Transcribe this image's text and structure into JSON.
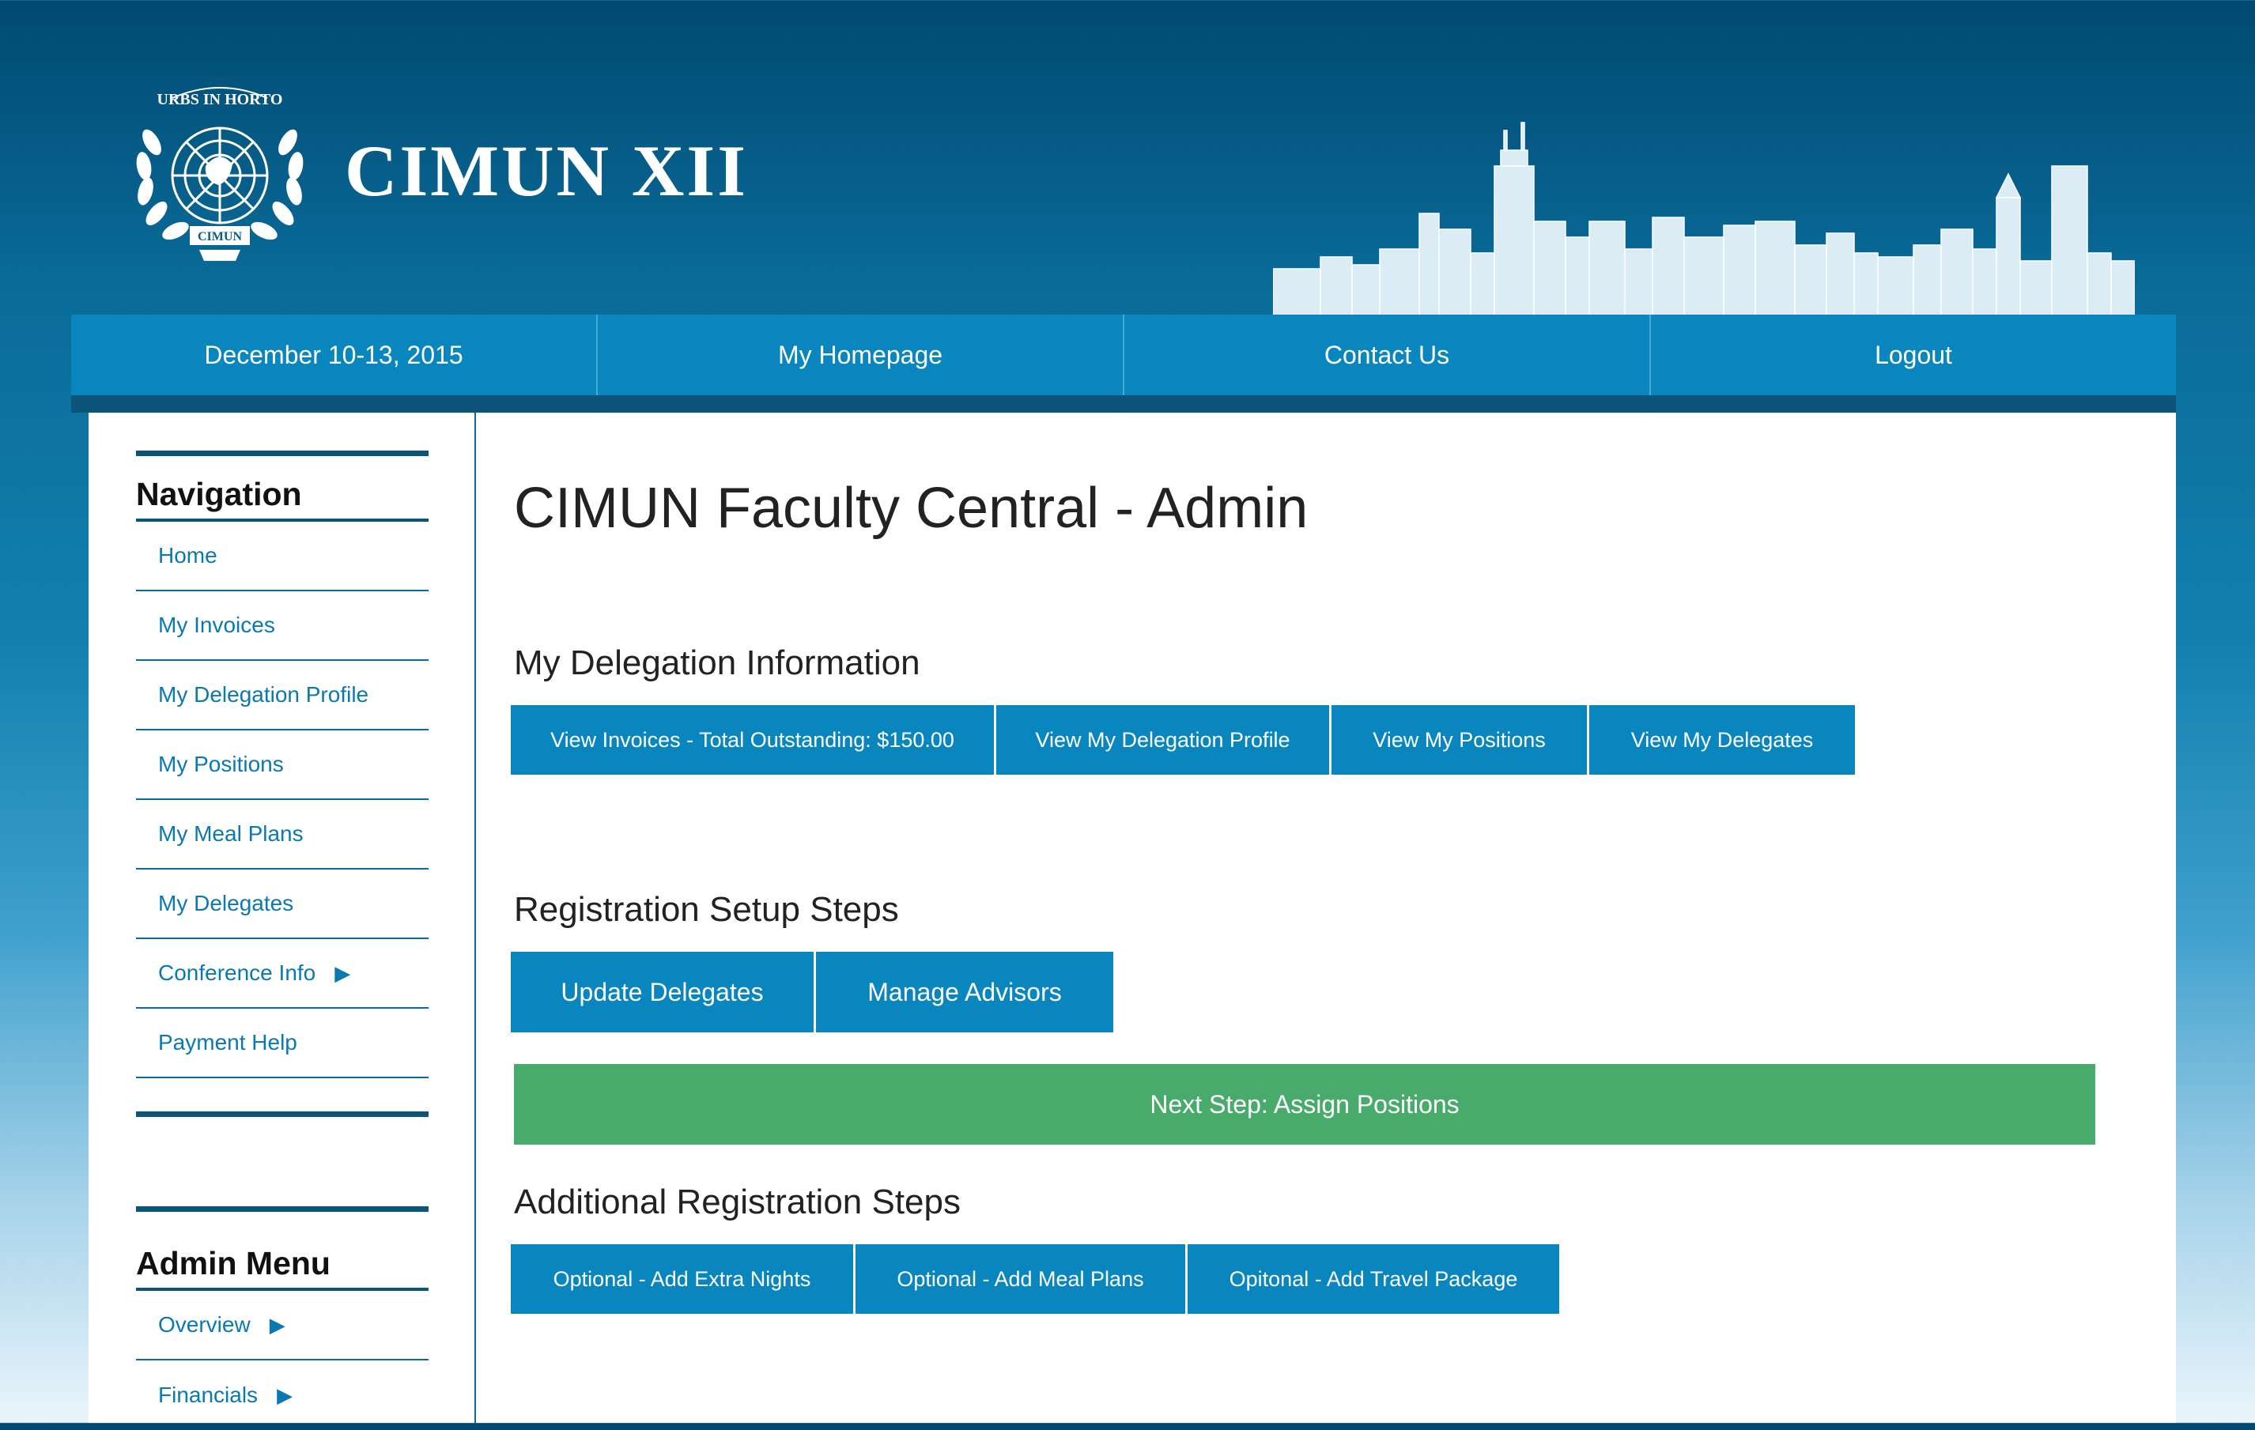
{
  "header": {
    "site_title": "CIMUN XII",
    "emblem_text_top": "URBS IN HORTO",
    "emblem_text_banner": "CIMUN"
  },
  "topnav": {
    "items": [
      {
        "label": "December 10-13, 2015"
      },
      {
        "label": "My Homepage"
      },
      {
        "label": "Contact Us"
      },
      {
        "label": "Logout"
      }
    ]
  },
  "sidebar": {
    "navigation": {
      "heading": "Navigation",
      "items": [
        {
          "label": "Home"
        },
        {
          "label": "My Invoices"
        },
        {
          "label": "My Delegation Profile"
        },
        {
          "label": "My Positions"
        },
        {
          "label": "My Meal Plans"
        },
        {
          "label": "My Delegates"
        },
        {
          "label": "Conference Info",
          "arrow": "▶"
        },
        {
          "label": "Payment Help"
        }
      ]
    },
    "admin": {
      "heading": "Admin Menu",
      "items": [
        {
          "label": "Overview",
          "arrow": "▶"
        },
        {
          "label": "Financials",
          "arrow": "▶"
        }
      ]
    }
  },
  "main": {
    "page_title": "CIMUN Faculty Central - Admin",
    "delegation": {
      "title": "My Delegation Information",
      "buttons": [
        {
          "label": "View Invoices - Total Outstanding: $150.00"
        },
        {
          "label": "View My Delegation Profile"
        },
        {
          "label": "View My Positions"
        },
        {
          "label": "View My Delegates"
        }
      ]
    },
    "setup": {
      "title": "Registration Setup Steps",
      "buttons": [
        {
          "label": "Update Delegates"
        },
        {
          "label": "Manage Advisors"
        }
      ],
      "next_step": "Next Step: Assign Positions"
    },
    "additional": {
      "title": "Additional Registration Steps",
      "buttons": [
        {
          "label": "Optional - Add Extra Nights"
        },
        {
          "label": "Optional - Add Meal Plans"
        },
        {
          "label": "Opitonal - Add Travel Package"
        }
      ]
    }
  },
  "colors": {
    "nav_blue": "#0a86bf",
    "dark_blue": "#0c5478",
    "link_blue": "#0a79b2",
    "green": "#48ab6c"
  }
}
